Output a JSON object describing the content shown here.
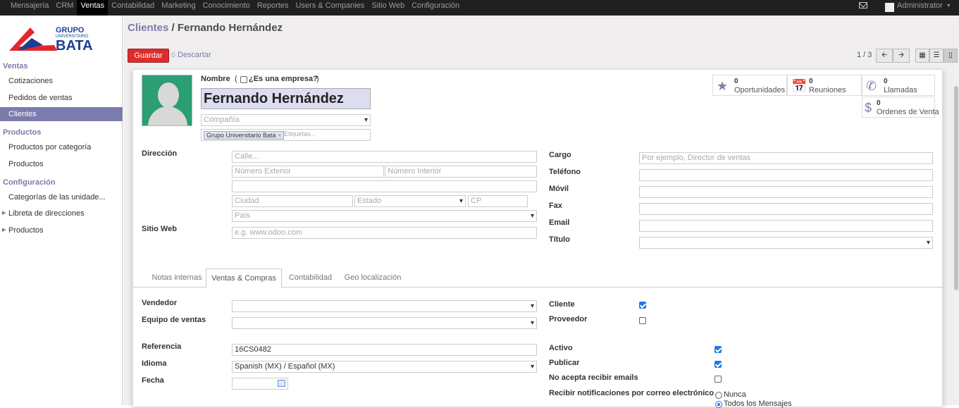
{
  "topbar": {
    "menu": [
      "Mensajería",
      "CRM",
      "Ventas",
      "Contabilidad",
      "Marketing",
      "Conocimiento",
      "Reportes",
      "Users & Companies",
      "Sitio Web",
      "Configuración"
    ],
    "user": "Administrator"
  },
  "logo": {
    "line1": "GRUPO",
    "line2": "UNIVERSITARIO",
    "line3": "BATA"
  },
  "sidebar": {
    "sec_ventas": "Ventas",
    "cotizaciones": "Cotizaciones",
    "pedidos": "Pedidos de ventas",
    "clientes": "Clientes",
    "sec_productos": "Productos",
    "prod_categoria": "Productos por categoría",
    "productos": "Productos",
    "sec_config": "Configuración",
    "categorias": "Categorías de las unidade...",
    "libreta": "Libreta de direcciones",
    "productos2": "Productos"
  },
  "breadcrumb": {
    "parent": "Clientes",
    "sep": " / ",
    "current": "Fernando Hernández"
  },
  "actions": {
    "save": "Guardar",
    "or": "ó",
    "discard": "Descartar"
  },
  "pager": {
    "text": "1 / 3"
  },
  "form": {
    "name_label": "Nombre",
    "company_check_label": "¿Es una empresa?",
    "name_value": "Fernando Hernández",
    "company_placeholder": "Compañía",
    "tag": "Grupo Universitario Bata",
    "tags_placeholder": "Etiquetas...",
    "smart": [
      {
        "num": "0",
        "label": "Oportunidades"
      },
      {
        "num": "0",
        "label": "Reuniones"
      },
      {
        "num": "0",
        "label": "Llamadas"
      },
      {
        "num": "0",
        "label": "Ordenes de Venta"
      }
    ],
    "direccion_label": "Dirección",
    "calle_ph": "Calle...",
    "num_ext_ph": "Número Exterior",
    "num_int_ph": "Número Interior",
    "ciudad_ph": "Ciudad",
    "estado_ph": "Estado",
    "cp_ph": "CP",
    "pais_ph": "País",
    "sitio_label": "Sitio Web",
    "sitio_ph": "e.g. www.odoo.com",
    "cargo_label": "Cargo",
    "cargo_ph": "Por ejemplo, Director de ventas",
    "telefono_label": "Teléfono",
    "movil_label": "Móvil",
    "fax_label": "Fax",
    "email_label": "Email",
    "titulo_label": "Título"
  },
  "tabs": [
    "Notas internas",
    "Ventas & Compras",
    "Contabilidad",
    "Geo localización"
  ],
  "sales": {
    "vendedor_label": "Vendedor",
    "equipo_label": "Equipo de ventas",
    "cliente_label": "Cliente",
    "proveedor_label": "Proveedor",
    "referencia_label": "Referencia",
    "referencia_value": "16CS0482",
    "idioma_label": "Idioma",
    "idioma_value": "Spanish (MX) / Español (MX)",
    "fecha_label": "Fecha",
    "activo_label": "Activo",
    "publicar_label": "Publicar",
    "no_emails_label": "No acepta recibir emails",
    "notif_label": "Recibir notificaciones por correo electrónico",
    "notif_options": [
      "Nunca",
      "Todos los Mensajes"
    ]
  }
}
